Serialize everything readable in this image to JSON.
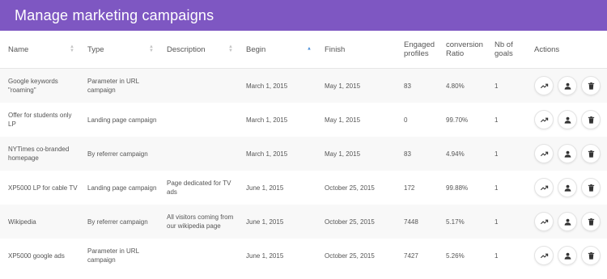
{
  "header": {
    "title": "Manage marketing campaigns"
  },
  "columns": {
    "name": "Name",
    "type": "Type",
    "description": "Description",
    "begin": "Begin",
    "finish": "Finish",
    "engaged_line1": "Engaged",
    "engaged_line2": "profiles",
    "conversion_line1": "conversion",
    "conversion_line2": "Ratio",
    "goals_line1": "Nb of",
    "goals_line2": "goals",
    "actions": "Actions"
  },
  "icons": {
    "stats": "trending-up-icon",
    "user": "person-icon",
    "delete": "trash-icon"
  },
  "rows": [
    {
      "name": "Google keywords \"roaming\"",
      "type": "Parameter in URL campaign",
      "description": "",
      "begin": "March 1, 2015",
      "finish": "May 1, 2015",
      "engaged": "83",
      "conversion": "4.80%",
      "goals": "1"
    },
    {
      "name": "Offer for students only LP",
      "type": "Landing page campaign",
      "description": "",
      "begin": "March 1, 2015",
      "finish": "May 1, 2015",
      "engaged": "0",
      "conversion": "99.70%",
      "goals": "1"
    },
    {
      "name": "NYTimes co-branded homepage",
      "type": "By referrer campaign",
      "description": "",
      "begin": "March 1, 2015",
      "finish": "May 1, 2015",
      "engaged": "83",
      "conversion": "4.94%",
      "goals": "1"
    },
    {
      "name": "XP5000 LP for cable TV",
      "type": "Landing page campaign",
      "description": "Page dedicated for TV ads",
      "begin": "June 1, 2015",
      "finish": "October 25, 2015",
      "engaged": "172",
      "conversion": "99.88%",
      "goals": "1"
    },
    {
      "name": "Wikipedia",
      "type": "By referrer campaign",
      "description": "All visitors coming from our wikipedia page",
      "begin": "June 1, 2015",
      "finish": "October 25, 2015",
      "engaged": "7448",
      "conversion": "5.17%",
      "goals": "1"
    },
    {
      "name": "XP5000 google ads",
      "type": "Parameter in URL campaign",
      "description": "",
      "begin": "June 1, 2015",
      "finish": "October 25, 2015",
      "engaged": "7427",
      "conversion": "5.26%",
      "goals": "1"
    }
  ]
}
